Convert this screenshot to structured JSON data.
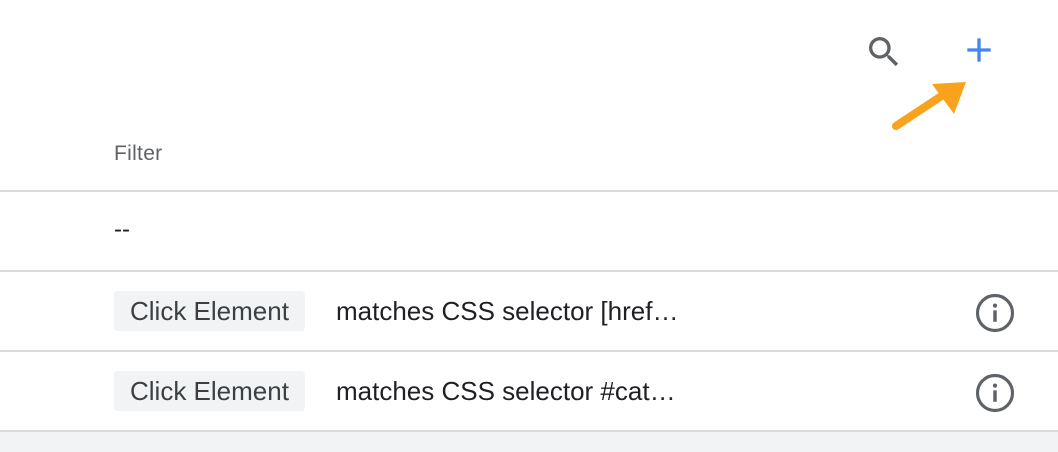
{
  "toolbar": {
    "search_icon": "search-icon",
    "add_icon": "plus-icon",
    "accent_color": "#4285f4",
    "annotation_arrow_color": "#f9a21b"
  },
  "table": {
    "header": "Filter",
    "rows": [
      {
        "text": "--"
      },
      {
        "chip": "Click Element",
        "condition": "matches CSS selector [href…",
        "info_icon": "info-icon"
      },
      {
        "chip": "Click Element",
        "condition": "matches CSS selector #cat…",
        "info_icon": "info-icon"
      }
    ]
  }
}
